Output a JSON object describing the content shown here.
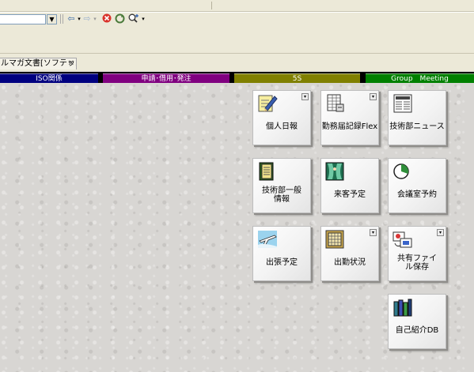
{
  "browser": {
    "toolbar": {
      "url_value": "",
      "icons": [
        "back-arrow-icon",
        "forward-arrow-icon",
        "stop-icon",
        "refresh-icon",
        "zoom-icon"
      ]
    },
    "tab": {
      "title": "ルマガ文書[ソフテッ...",
      "close_glyph": "✕"
    }
  },
  "categories": [
    {
      "label": "ISO関係",
      "color": "#000080"
    },
    {
      "label": "申請･借用･発注",
      "color": "#800080"
    },
    {
      "label": "5S",
      "color": "#808000"
    },
    {
      "label": "Group　Meeting",
      "color": "#008000"
    }
  ],
  "tiles": [
    {
      "id": "personal-daily-report",
      "label": "個人日報",
      "icon": "pen-notepad-icon",
      "has_menu": true
    },
    {
      "id": "attendance-flex",
      "label": "勤務届記録Flex",
      "icon": "form-sheet-icon",
      "has_menu": true
    },
    {
      "id": "tech-news",
      "label": "技術部ニュース",
      "icon": "newspaper-icon",
      "has_menu": false
    },
    {
      "id": "tech-general-info",
      "label": "技術部一般情報",
      "icon": "binder-icon",
      "has_menu": false
    },
    {
      "id": "visitor-schedule",
      "label": "来客予定",
      "icon": "door-curtain-icon",
      "has_menu": false
    },
    {
      "id": "meeting-room-booking",
      "label": "会議室予約",
      "icon": "clock-pie-icon",
      "has_menu": false
    },
    {
      "id": "business-trip",
      "label": "出張予定",
      "icon": "airplane-icon",
      "has_menu": false
    },
    {
      "id": "attendance-status",
      "label": "出勤状況",
      "icon": "calendar-grid-icon",
      "has_menu": true
    },
    {
      "id": "shared-file-store",
      "label": "共有ファイル保存",
      "icon": "shared-files-icon",
      "has_menu": true
    },
    {
      "id": "self-intro-db",
      "label": "自己紹介DB",
      "icon": "books-icon",
      "has_menu": false
    }
  ],
  "menu_glyph": "▾"
}
